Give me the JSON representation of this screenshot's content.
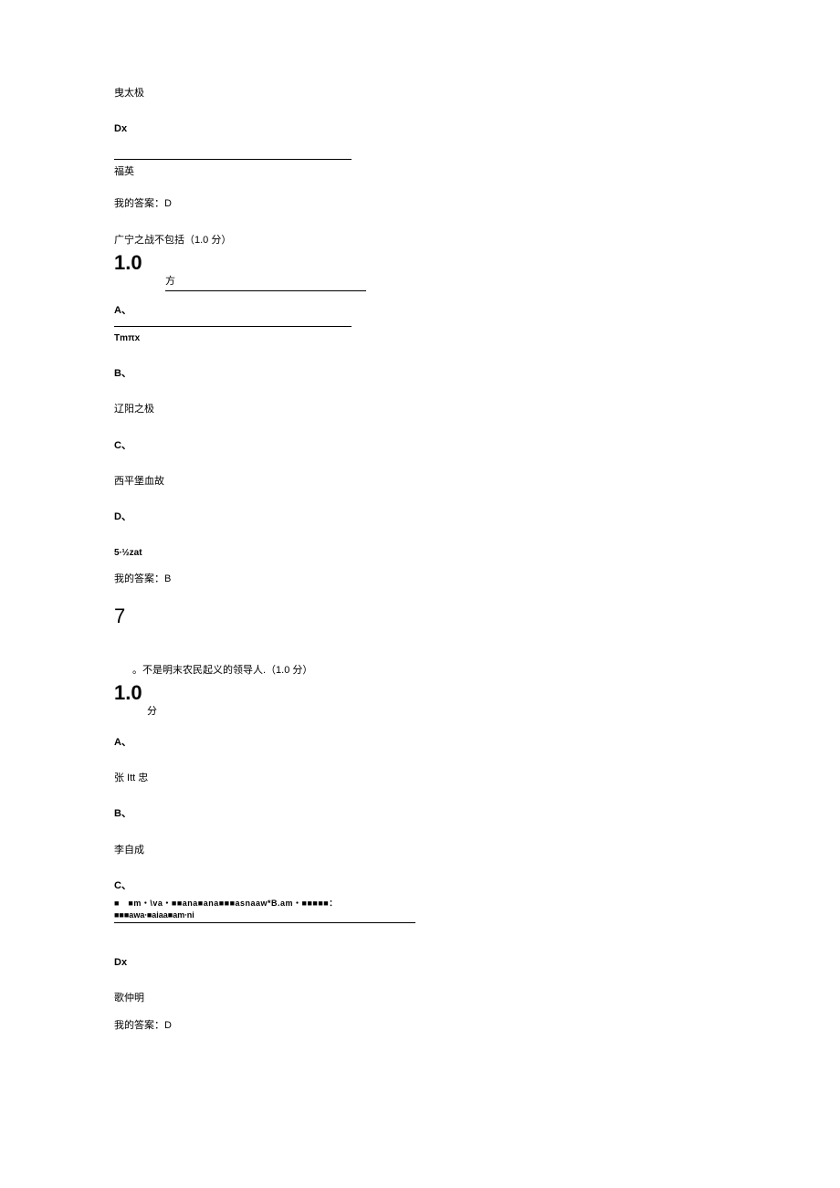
{
  "q5_frag": {
    "opt_c_text": "曳太极",
    "opt_d_label": "Dx",
    "opt_d_text": "福英",
    "answer_label": "我的答案：D"
  },
  "q6": {
    "stem": "广宁之战不包括（1.0 分）",
    "score": "1.0",
    "score_sub": "方",
    "a_label": "A、",
    "a_text": "Tmπx",
    "b_label": "B、",
    "b_text": "辽阳之极",
    "c_label": "C、",
    "c_text": "西平堡血故",
    "d_label": "D、",
    "d_text": "5∙½zat",
    "answer_label": "我的答案：B"
  },
  "q7": {
    "number": "7",
    "stem": "。不是明末农民起义的领导人.（1.0 分）",
    "score": "1.0",
    "score_sub": "分",
    "a_label": "A、",
    "a_text": "张 Itt 忠",
    "b_label": "B、",
    "b_text": "李自成",
    "c_label": "C、",
    "c_garble1": "■　■m・\\va・■■ana■ana■■■asnaaw*B.am・■■■■■：",
    "c_garble2": "■■■awa∙■aiaa■am∙ni",
    "d_label": "Dx",
    "d_text": "歌仲明",
    "answer_label": "我的答案：D"
  }
}
